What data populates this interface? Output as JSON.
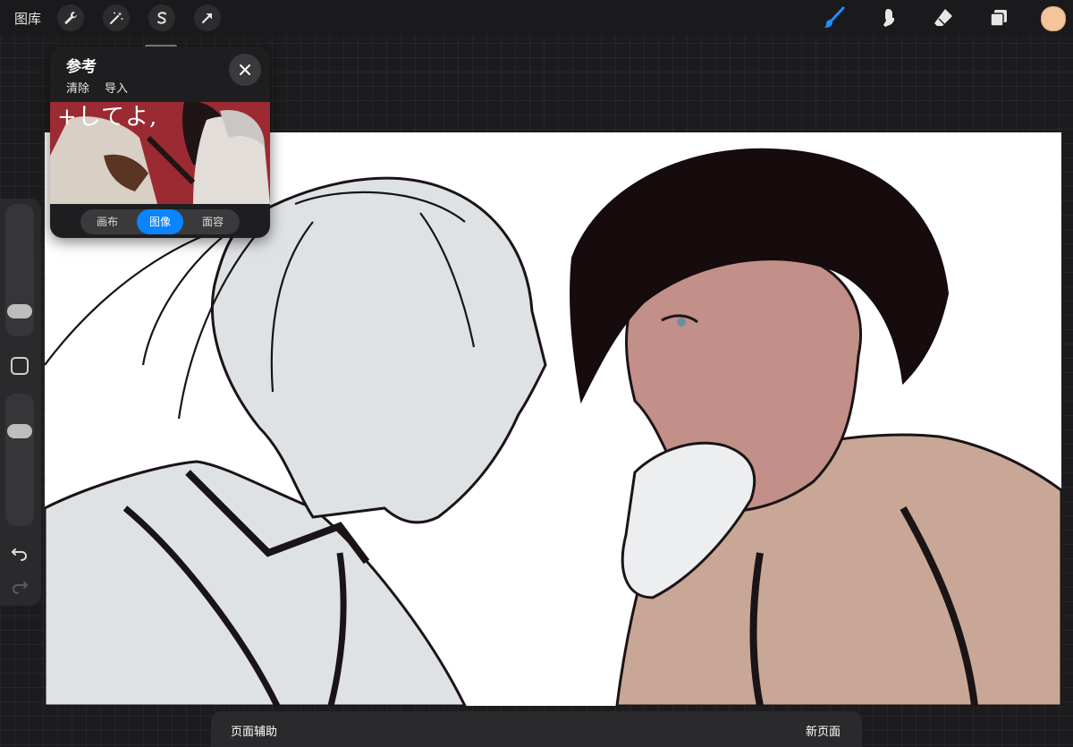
{
  "topbar": {
    "gallery_label": "图库",
    "left_tools": [
      {
        "icon": "wrench-icon"
      },
      {
        "icon": "magic-wand-icon"
      },
      {
        "icon": "selection-s-icon"
      },
      {
        "icon": "transform-arrow-icon"
      }
    ],
    "right_tools": [
      {
        "icon": "brush-icon",
        "active": true
      },
      {
        "icon": "smudge-icon"
      },
      {
        "icon": "eraser-icon"
      },
      {
        "icon": "layers-icon"
      }
    ],
    "active_color": "#f4c49a",
    "accent_color": "#1f8fff"
  },
  "reference_panel": {
    "title": "参考",
    "actions": {
      "clear": "清除",
      "import": "导入"
    },
    "image_overlay_text": "+してよ,",
    "tabs": [
      {
        "label": "画布",
        "active": false
      },
      {
        "label": "图像",
        "active": true
      },
      {
        "label": "面容",
        "active": false
      }
    ]
  },
  "bottombar": {
    "page_assist_label": "页面辅助",
    "new_page_label": "新页面"
  }
}
